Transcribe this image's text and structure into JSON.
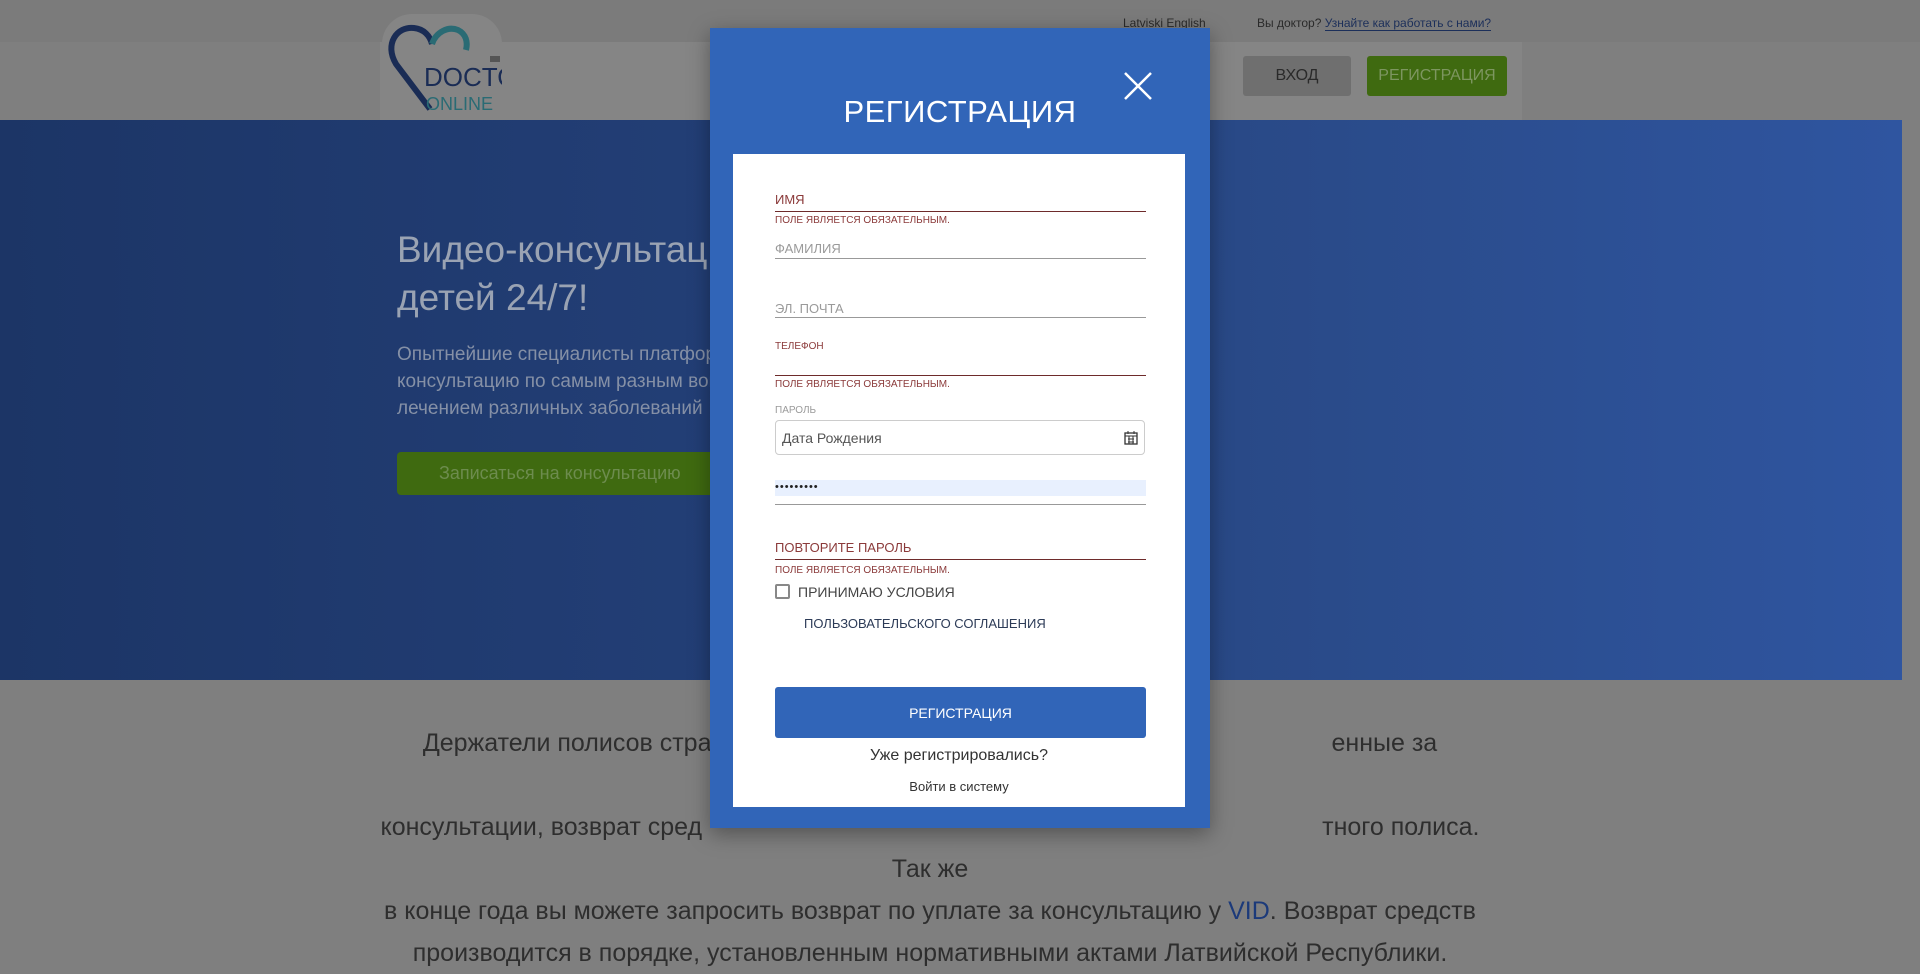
{
  "header": {
    "lang_links": "Latviski English",
    "doctor_question": "Вы доктор?",
    "doctor_link": "Узнайте как работать с нами?",
    "login_button": "ВХОД",
    "register_button": "РЕГИСТРАЦИЯ",
    "logo_text": "DOCTOR ONLINE BETA"
  },
  "hero": {
    "title_line1": "Видео-консультации",
    "title_line2": "детей 24/7!",
    "text_line1": "Опытнейшие специалисты платформы",
    "text_line2": "консультацию по самым разным вопр",
    "text_line3": "лечением различных заболеваний",
    "cta": "Записаться на консультацию"
  },
  "body": {
    "line1_a": "Держатели полисов стра",
    "line1_b": "енные за онлайн-",
    "line2_a": "консультации, возврат сред",
    "line2_b": "тного полиса. Так же",
    "line3_a": "в конце года вы можете запросить возврат по уплате за консультацию у ",
    "line3_vid": "VID",
    "line3_b": ". Возврат средств",
    "line4": "производится в порядке, установленным нормативными актами Латвийской Республики."
  },
  "modal": {
    "title": "РЕГИСТРАЦИЯ",
    "first_name_label": "ИМЯ",
    "required_msg": "ПОЛЕ ЯВЛЯЕТСЯ ОБЯЗАТЕЛЬНЫМ.",
    "last_name_label": "ФАМИЛИЯ",
    "email_label": "ЭЛ. ПОЧТА",
    "phone_label": "ТЕЛЕФОН",
    "birth_date_placeholder": "Дата Рождения",
    "password_label": "ПАРОЛЬ",
    "password_value": "•••••••••",
    "repeat_password_label": "ПОВТОРИТЕ ПАРОЛЬ",
    "accept_terms": "ПРИНИМАЮ УСЛОВИЯ",
    "agreement_link": "ПОЛЬЗОВАТЕЛЬСКОГО СОГЛАШЕНИЯ",
    "submit": "РЕГИСТРАЦИЯ",
    "already_registered": "Уже регистрировались?",
    "login_link": "Войти в систему"
  },
  "colors": {
    "modal_blue": "#3165b8",
    "error": "#8b3a3a",
    "green": "#6aa81e"
  }
}
